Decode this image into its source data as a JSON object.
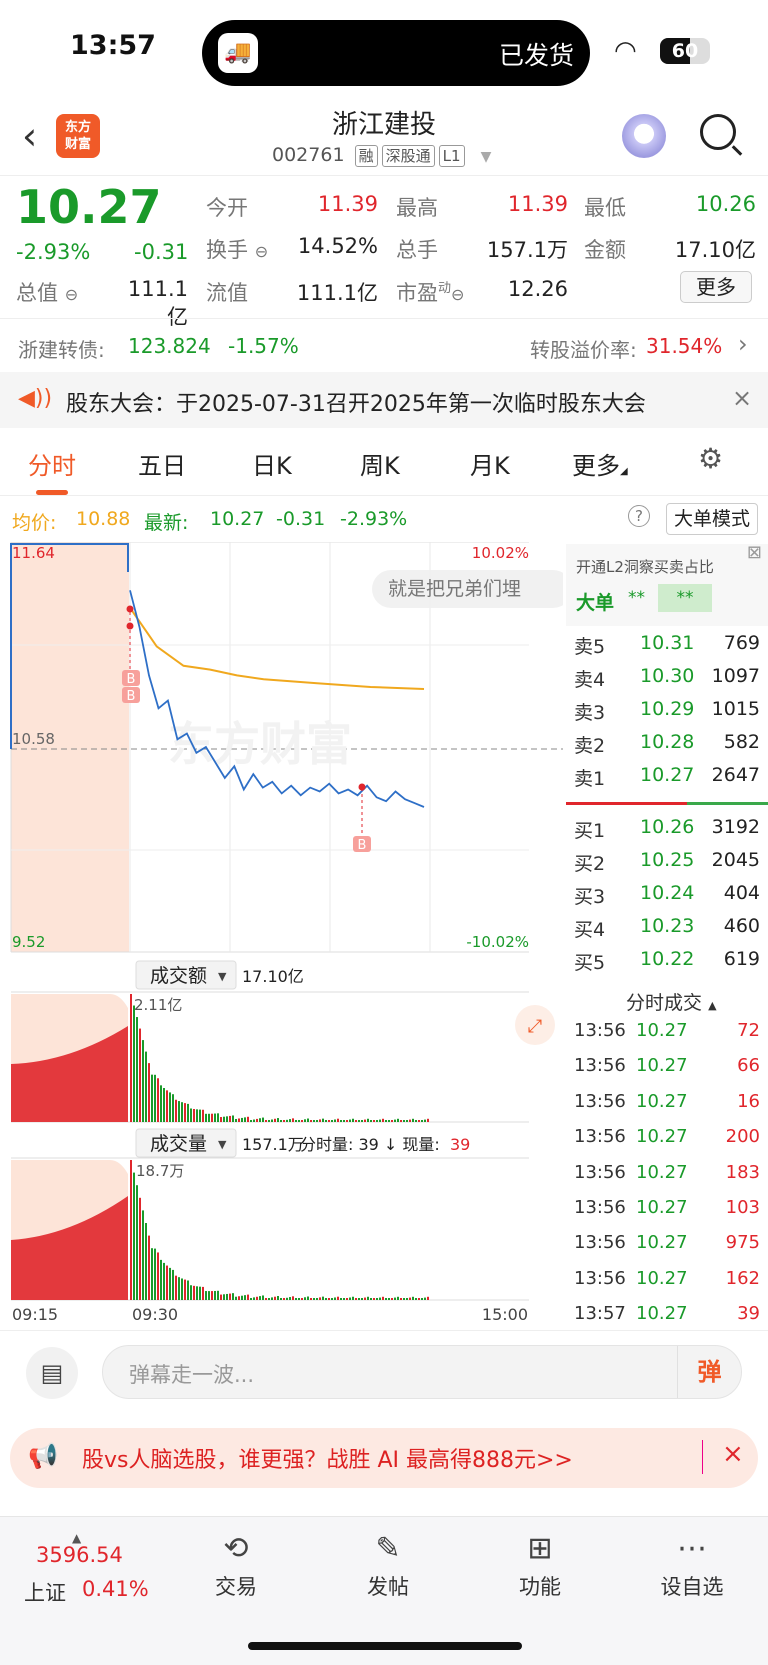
{
  "status": {
    "time": "13:57",
    "island_text": "已发货",
    "battery": "60",
    "icons": [
      "truck-icon",
      "wifi-icon",
      "battery-icon"
    ]
  },
  "header": {
    "title": "浙江建投",
    "code": "002761",
    "tags": [
      "融",
      "深股通",
      "L1"
    ],
    "logo_text": "东方财富"
  },
  "quote": {
    "price": "10.27",
    "change_pct": "-2.93%",
    "change": "-0.31",
    "stats": [
      {
        "label": "今开",
        "value": "11.39"
      },
      {
        "label": "最高",
        "value": "11.39"
      },
      {
        "label": "最低",
        "value": "10.26"
      },
      {
        "label": "换手",
        "value": "14.52%"
      },
      {
        "label": "总手",
        "value": "157.1万"
      },
      {
        "label": "金额",
        "value": "17.10亿"
      },
      {
        "label": "总值",
        "value": "111.1亿"
      },
      {
        "label": "流值",
        "value": "111.1亿"
      },
      {
        "label": "市盈",
        "value": "12.26",
        "sup": "动"
      }
    ],
    "more_label": "更多"
  },
  "bond": {
    "name": "浙建转债:",
    "price": "123.824",
    "pct": "-1.57%",
    "premium_label": "转股溢价率:",
    "premium": "31.54%"
  },
  "notice": {
    "text": "股东大会：于2025-07-31召开2025年第一次临时股东大会"
  },
  "tabs": [
    "分时",
    "五日",
    "日K",
    "周K",
    "月K",
    "更多"
  ],
  "info": {
    "avg_label": "均价:",
    "avg": "10.88",
    "latest_label": "最新:",
    "latest": "10.27",
    "chg": "-0.31",
    "pct": "-2.93%",
    "bigmode": "大单模式"
  },
  "chart": {
    "top_left": "11.64",
    "top_right": "10.02%",
    "mid": "10.58",
    "bottom_left": "9.52",
    "bottom_right": "-10.02%",
    "danmaku": "就是把兄弟们埋",
    "amount_label": "成交额",
    "amount": "17.10亿",
    "amount_max": "2.11亿",
    "volume_label": "成交量",
    "volume": "157.1万",
    "volume_info1": "分时量: 39 ↓ 现量:",
    "volume_now": "39",
    "volume_max": "18.7万",
    "x_start": "09:15",
    "x_mid": "09:30",
    "x_end": "15:00",
    "marker": "B"
  },
  "chart_data": {
    "type": "line",
    "series": [
      {
        "name": "最新",
        "color": "#2e6fc7",
        "y": [
          11.39,
          11.2,
          10.95,
          10.78,
          10.82,
          10.62,
          10.65,
          10.55,
          10.58,
          10.5,
          10.42,
          10.48,
          10.36,
          10.44,
          10.37,
          10.4,
          10.34,
          10.38,
          10.33,
          10.37,
          10.35,
          10.39,
          10.34,
          10.36,
          10.33,
          10.38,
          10.32,
          10.3,
          10.35,
          10.31,
          10.29,
          10.27
        ]
      },
      {
        "name": "均价",
        "color": "#f0a81e",
        "y": [
          11.3,
          11.1,
          11.0,
          10.98,
          10.95,
          10.93,
          10.92,
          10.91,
          10.9,
          10.89,
          10.885,
          10.88
        ]
      }
    ],
    "ylim": [
      9.52,
      11.64
    ],
    "ref": 10.58
  },
  "orderbook": {
    "l2_text": "开通L2洞察买卖占比",
    "big_label": "大单",
    "big_v1": "**",
    "big_v2": "**",
    "asks": [
      {
        "l": "卖5",
        "p": "10.31",
        "v": "769"
      },
      {
        "l": "卖4",
        "p": "10.30",
        "v": "1097"
      },
      {
        "l": "卖3",
        "p": "10.29",
        "v": "1015"
      },
      {
        "l": "卖2",
        "p": "10.28",
        "v": "582"
      },
      {
        "l": "卖1",
        "p": "10.27",
        "v": "2647"
      }
    ],
    "bids": [
      {
        "l": "买1",
        "p": "10.26",
        "v": "3192"
      },
      {
        "l": "买2",
        "p": "10.25",
        "v": "2045"
      },
      {
        "l": "买3",
        "p": "10.24",
        "v": "404"
      },
      {
        "l": "买4",
        "p": "10.23",
        "v": "460"
      },
      {
        "l": "买5",
        "p": "10.22",
        "v": "619"
      }
    ],
    "ticks_title": "分时成交",
    "ticks": [
      {
        "t": "13:56",
        "p": "10.27",
        "v": "72"
      },
      {
        "t": "13:56",
        "p": "10.27",
        "v": "66"
      },
      {
        "t": "13:56",
        "p": "10.27",
        "v": "16"
      },
      {
        "t": "13:56",
        "p": "10.27",
        "v": "200"
      },
      {
        "t": "13:56",
        "p": "10.27",
        "v": "183"
      },
      {
        "t": "13:56",
        "p": "10.27",
        "v": "103"
      },
      {
        "t": "13:56",
        "p": "10.27",
        "v": "975"
      },
      {
        "t": "13:56",
        "p": "10.27",
        "v": "162"
      },
      {
        "t": "13:57",
        "p": "10.27",
        "v": "39"
      }
    ]
  },
  "danmu": {
    "placeholder": "弹幕走一波...",
    "send": "弹"
  },
  "promo": {
    "text": "股vs人脑选股，谁更强？战胜 AI 最高得888元>>"
  },
  "nav": {
    "index_value": "3596.54",
    "index_name": "上证",
    "index_pct": "0.41%",
    "items": [
      "交易",
      "发帖",
      "功能",
      "设自选"
    ]
  }
}
